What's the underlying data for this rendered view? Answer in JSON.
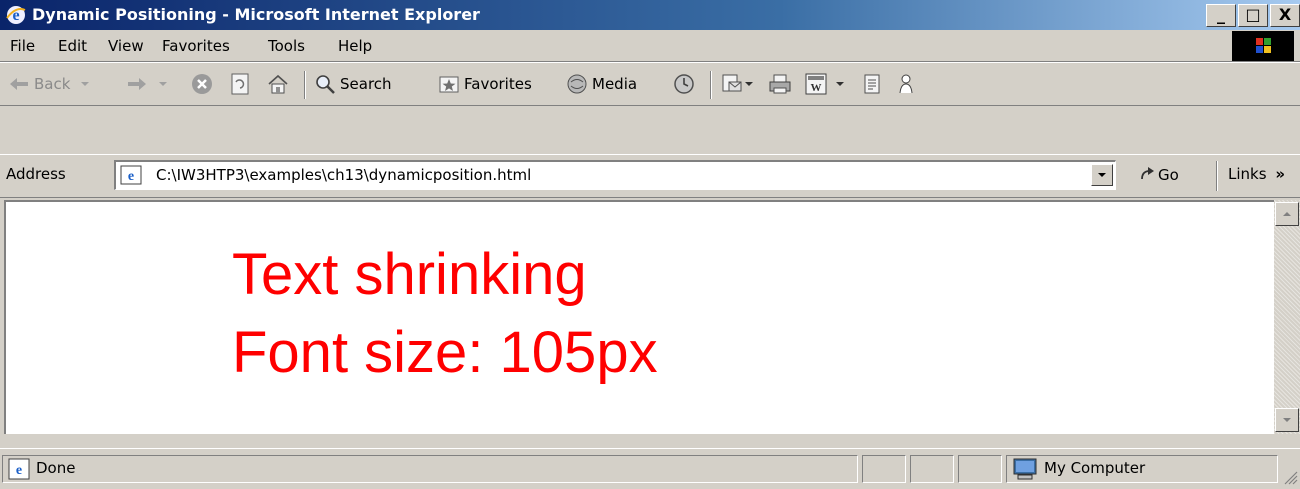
{
  "window": {
    "title": "Dynamic Positioning - Microsoft Internet Explorer",
    "buttons": [
      "_",
      "□",
      "X"
    ]
  },
  "menu": [
    "File",
    "Edit",
    "View",
    "Favorites",
    "Tools",
    "Help"
  ],
  "toolbar": {
    "back": "Back",
    "search": "Search",
    "favorites": "Favorites",
    "media": "Media"
  },
  "address": {
    "label": "Address",
    "url": "C:\\IW3HTP3\\examples\\ch13\\dynamicposition.html",
    "go": "Go",
    "links": "Links",
    "links_chevron": "»"
  },
  "page": {
    "line1": "Text shrinking",
    "line2": "Font size: 105px",
    "text_color": "#ff0000"
  },
  "status": {
    "text": "Done",
    "zone": "My Computer"
  }
}
